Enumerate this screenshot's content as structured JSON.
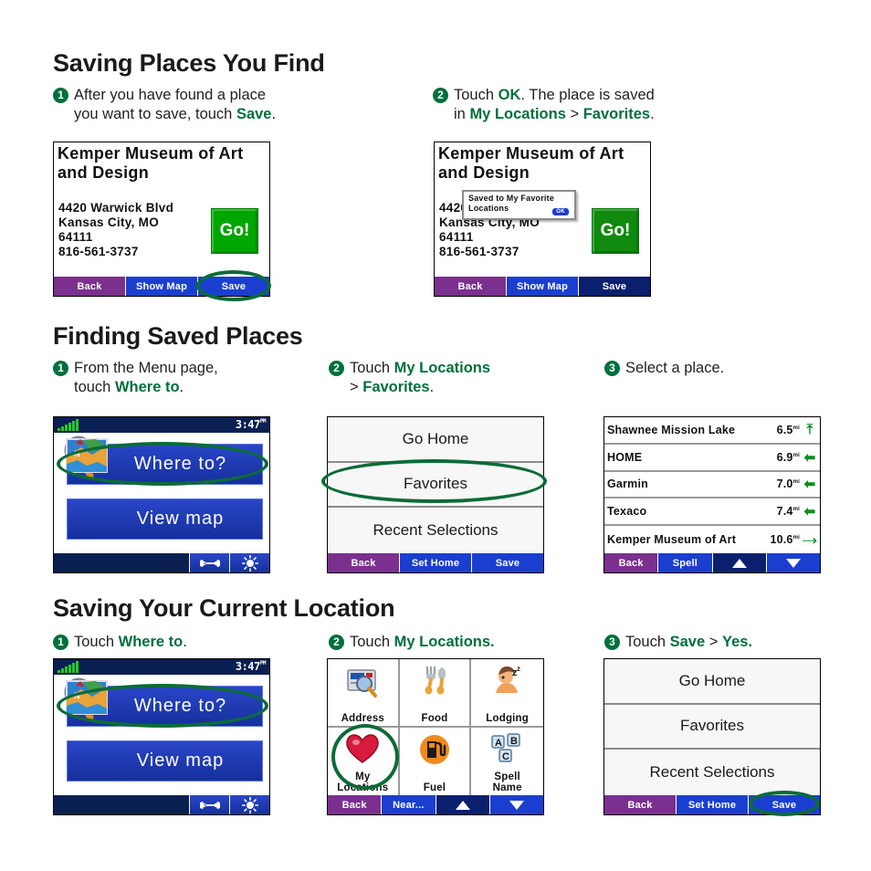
{
  "sections": [
    {
      "title": "Saving Places You Find",
      "steps": [
        {
          "num": "1",
          "line1_pre": "After you have found a place",
          "line2_pre": "you want to save, touch ",
          "line2_bold": "Save",
          "line2_post": "."
        },
        {
          "num": "2",
          "line1_pre": "Touch ",
          "line1_bold": "OK",
          "line1_post": ". The place is saved",
          "line2_pre": "in ",
          "line2_bold": "My Locations",
          "line2_mid": " > ",
          "line2_bold2": "Favorites",
          "line2_post": "."
        }
      ]
    },
    {
      "title": "Finding Saved Places",
      "steps": [
        {
          "num": "1",
          "line1_pre": "From the Menu page,",
          "line2_pre": "touch ",
          "line2_bold": "Where to",
          "line2_post": "."
        },
        {
          "num": "2",
          "line1_pre": "Touch ",
          "line1_bold": "My Locations",
          "line2_pre": "> ",
          "line2_bold": "Favorites",
          "line2_post": "."
        },
        {
          "num": "3",
          "line1_pre": "Select a place."
        }
      ]
    },
    {
      "title": "Saving Your Current Location",
      "steps": [
        {
          "num": "1",
          "line1_pre": "Touch ",
          "line1_bold": "Where to",
          "line1_post": "."
        },
        {
          "num": "2",
          "line1_pre": "Touch ",
          "line1_bold": "My Locations."
        },
        {
          "num": "3",
          "line1_pre": "Touch ",
          "line1_bold": "Save",
          "line1_mid": " > ",
          "line1_bold2": "Yes."
        }
      ]
    }
  ],
  "place_detail": {
    "title": "Kemper Museum of Art and Design",
    "address_line1": "4420 Warwick Blvd",
    "address_line2": "Kansas City, MO",
    "address_line3": "64111",
    "address_line4": "816-561-3737",
    "go_label": "Go!",
    "buttons": [
      "Back",
      "Show Map",
      "Save"
    ]
  },
  "saved_dialog": {
    "message_line1": "Saved to My Favorite",
    "message_line2": "Locations",
    "ok_label": "OK"
  },
  "menu_screen": {
    "clock": "3:47",
    "clock_sup": "PM",
    "where_to_label": "Where to?",
    "view_map_label": "View map",
    "tools_icon": "wrench-icon",
    "brightness_icon": "brightness-icon",
    "signal_icon": "signal-bars-icon"
  },
  "my_locations_menu": {
    "rows": [
      "Go Home",
      "Favorites",
      "Recent Selections"
    ],
    "buttons": [
      "Back",
      "Set Home",
      "Save"
    ]
  },
  "favorites_list": {
    "rows": [
      {
        "name": "Shawnee Mission Lake",
        "distance": "6.5",
        "unit": "mi",
        "arrow": "up-left-arrow-icon"
      },
      {
        "name": "HOME",
        "distance": "6.9",
        "unit": "mi",
        "arrow": "left-arrow-icon"
      },
      {
        "name": "Garmin",
        "distance": "7.0",
        "unit": "mi",
        "arrow": "left-arrow-icon"
      },
      {
        "name": "Texaco",
        "distance": "7.4",
        "unit": "mi",
        "arrow": "left-arrow-icon"
      },
      {
        "name": "Kemper Museum of Art",
        "distance": "10.6",
        "unit": "mi",
        "arrow": "up-right-arrow-icon"
      }
    ],
    "buttons": [
      "Back",
      "Spell",
      "up-arrow",
      "down-arrow"
    ]
  },
  "category_grid": {
    "cells": [
      {
        "label": "Address",
        "icon": "address-card-icon"
      },
      {
        "label": "Food",
        "icon": "fork-spoon-icon"
      },
      {
        "label": "Lodging",
        "icon": "sleeping-person-icon"
      },
      {
        "label": "My\nLocations",
        "label1": "My",
        "label2": "Locations",
        "icon": "heart-icon"
      },
      {
        "label": "Fuel",
        "icon": "fuel-pump-icon"
      },
      {
        "label": "Spell\nName",
        "label1": "Spell",
        "label2": "Name",
        "icon": "abc-keys-icon"
      }
    ],
    "buttons": [
      "Back",
      "Near...",
      "up-arrow",
      "down-arrow"
    ]
  },
  "colors": {
    "green_accent": "#00703c",
    "highlight_ellipse": "#0c6b38",
    "button_blue": "#1a3fd0",
    "button_purple": "#7b2f8e",
    "go_green": "#00a600",
    "status_navy": "#0a1f52"
  }
}
